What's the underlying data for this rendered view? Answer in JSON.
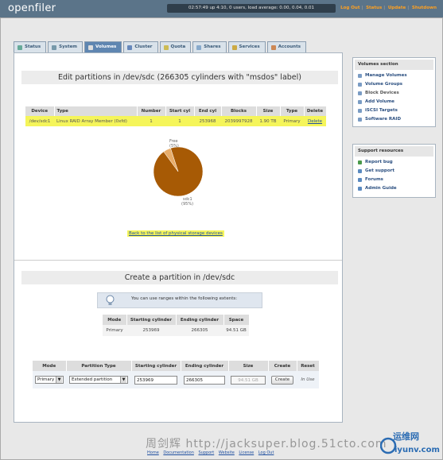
{
  "header": {
    "logo": "openfiler",
    "status": "02:57:49 up 4:10, 0 users, load average: 0.00, 0.04, 0.01",
    "links": [
      "Log Out",
      "Status",
      "Update",
      "Shutdown"
    ]
  },
  "tabs": [
    {
      "label": "Status",
      "icon": "status-icon"
    },
    {
      "label": "System",
      "icon": "system-icon"
    },
    {
      "label": "Volumes",
      "icon": "volumes-icon",
      "active": true
    },
    {
      "label": "Cluster",
      "icon": "cluster-icon"
    },
    {
      "label": "Quota",
      "icon": "quota-icon"
    },
    {
      "label": "Shares",
      "icon": "shares-icon"
    },
    {
      "label": "Services",
      "icon": "services-icon"
    },
    {
      "label": "Accounts",
      "icon": "accounts-icon"
    }
  ],
  "edit": {
    "title": "Edit partitions in /dev/sdc (266305 cylinders with \"msdos\" label)",
    "columns": [
      "Device",
      "Type",
      "Number",
      "Start cyl",
      "End cyl",
      "Blocks",
      "Size",
      "Type",
      "Delete"
    ],
    "row": [
      "/dev/sdc1",
      "Linux RAID Array Member (0xfd)",
      "1",
      "1",
      "253968",
      "2039997928",
      "1.90 TB",
      "Primary",
      "Delete"
    ],
    "back_link": "Back to the list of physical storage devices"
  },
  "chart_data": {
    "type": "pie",
    "slices": [
      {
        "label": "sdc1",
        "pct_label": "(95%)",
        "value": 95,
        "color": "#a75a05"
      },
      {
        "label": "Free",
        "pct_label": "(5%)",
        "value": 5,
        "color": "#e8ad6a"
      }
    ]
  },
  "create": {
    "title": "Create a partition in /dev/sdc",
    "info": "You can use ranges within the following extents:",
    "extent_columns": [
      "Mode",
      "Starting cylinder",
      "Ending cylinder",
      "Space"
    ],
    "extent_row": [
      "Primary",
      "253969",
      "266305",
      "94.51 GB"
    ],
    "form_columns": [
      "Mode",
      "Partition Type",
      "Starting cylinder",
      "Ending cylinder",
      "Size",
      "Create",
      "Reset"
    ],
    "mode_value": "Primary",
    "ptype_value": "Extended partition",
    "start_value": "253969",
    "end_value": "266305",
    "size_value": "94.51 GB",
    "create_label": "Create",
    "reset_label": "In Use"
  },
  "sidebar": {
    "volumes_title": "Volumes section",
    "volumes_items": [
      "Manage Volumes",
      "Volume Groups",
      "Block Devices",
      "Add Volume",
      "iSCSI Targets",
      "Software RAID"
    ],
    "support_title": "Support resources",
    "support_items": [
      "Report bug",
      "Get support",
      "Forums",
      "Admin Guide"
    ]
  },
  "footer": {
    "links": [
      "Home",
      "Documentation",
      "Support",
      "Website",
      "License",
      "Log Out"
    ]
  },
  "watermark": {
    "text": "周剑辉 http://jacksuper.blog.51cto.com",
    "logo_cn": "运维网",
    "logo_en": "iyunv.com"
  }
}
